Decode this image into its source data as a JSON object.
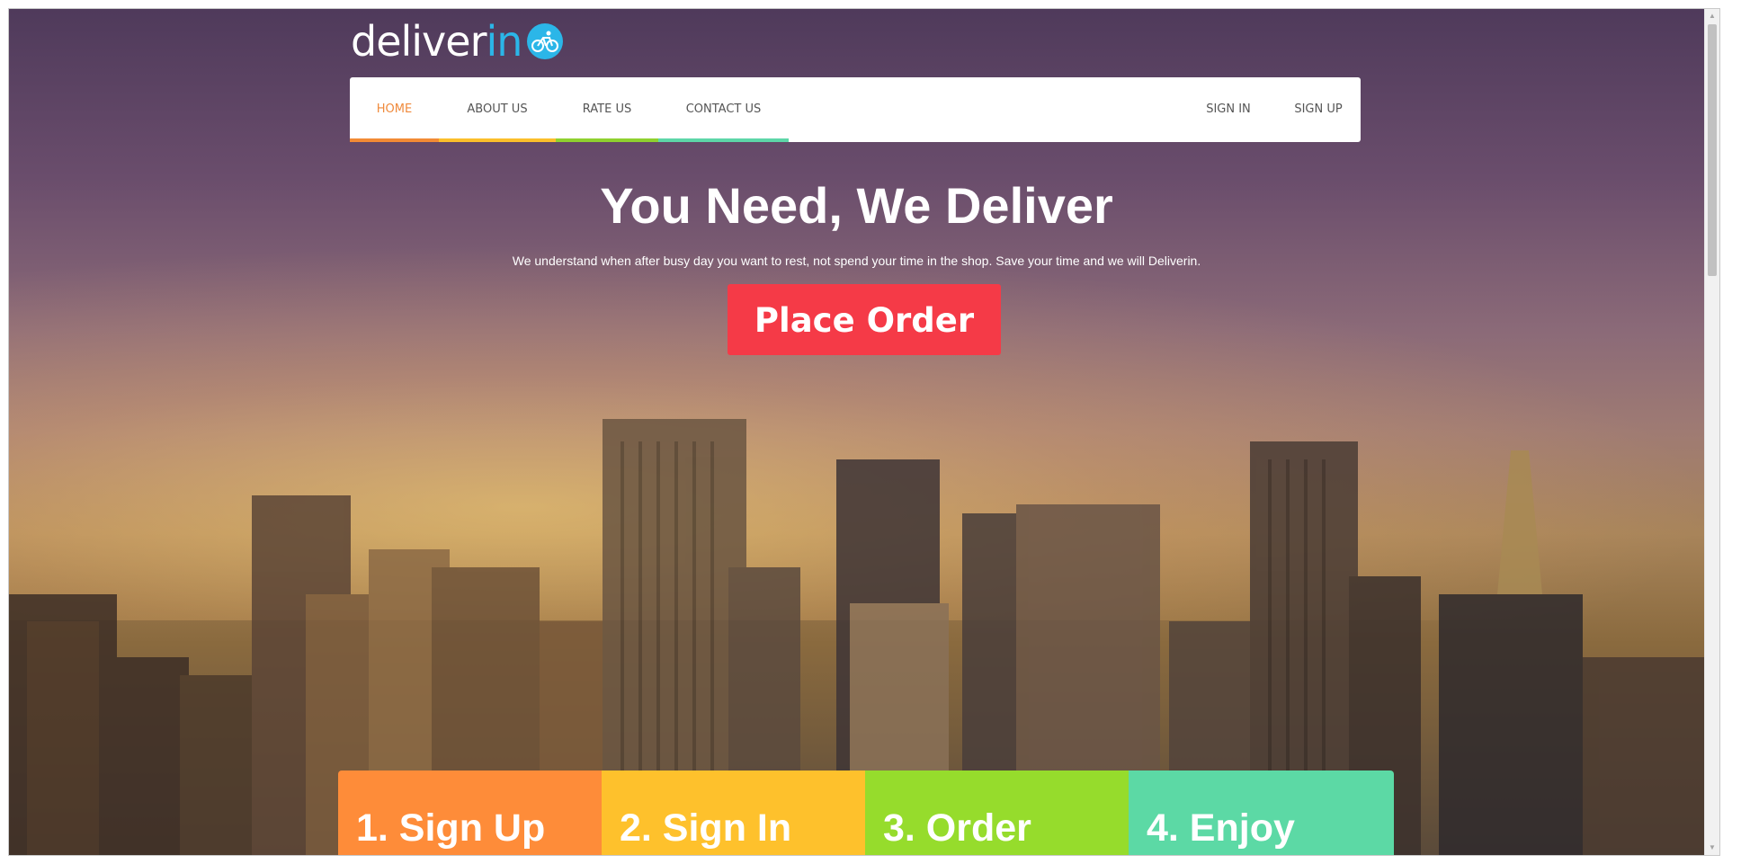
{
  "brand": {
    "logo_main": "deliver",
    "logo_accent": "in",
    "logo_icon": "bicycle-icon",
    "accent_color": "#2bb6e8"
  },
  "nav": {
    "left_items": [
      {
        "label": "HOME",
        "active": true
      },
      {
        "label": "ABOUT US",
        "active": false
      },
      {
        "label": "RATE US",
        "active": false
      },
      {
        "label": "CONTACT US",
        "active": false
      }
    ],
    "right_items": [
      {
        "label": "SIGN IN"
      },
      {
        "label": "SIGN UP"
      }
    ],
    "active_color": "#f08a3c",
    "stripe_colors": [
      "#f28b35",
      "#fbbf2b",
      "#8fd12f",
      "#5dd6a8"
    ]
  },
  "hero": {
    "title": "You Need, We Deliver",
    "subtitle": "We understand when after busy day you want to rest, not spend your time in the shop. Save your time and we will Deliverin.",
    "cta_label": "Place Order",
    "cta_color": "#f53a47"
  },
  "steps": [
    {
      "label": "1. Sign Up",
      "color": "#fe8c39"
    },
    {
      "label": "2. Sign In",
      "color": "#fec12c"
    },
    {
      "label": "3. Order",
      "color": "#96dc2c"
    },
    {
      "label": "4. Enjoy",
      "color": "#5cd9a5"
    }
  ]
}
